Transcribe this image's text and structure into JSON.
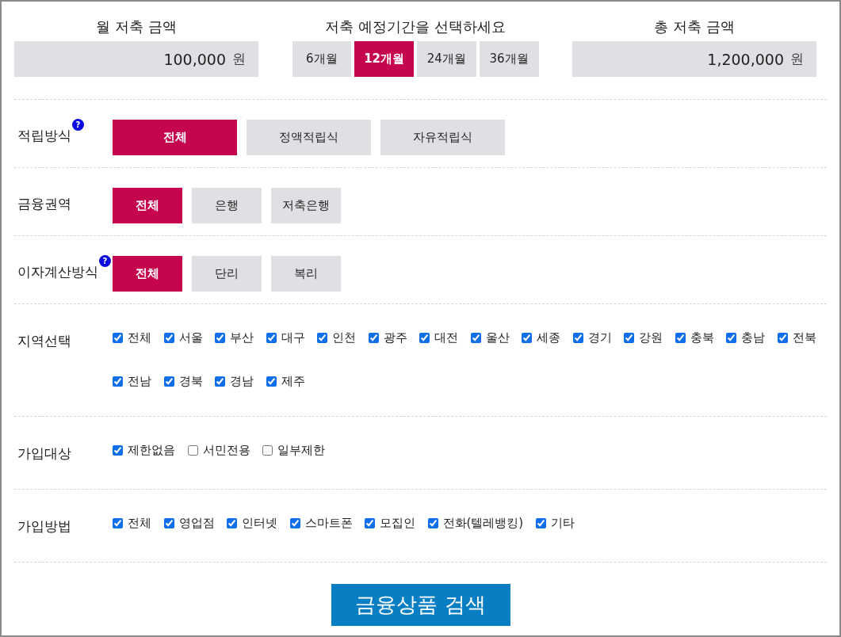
{
  "monthly_savings": {
    "label": "월 저축 금액",
    "value": "100,000",
    "unit": "원"
  },
  "period": {
    "label": "저축 예정기간을 선택하세요",
    "options": [
      {
        "label": "6개월",
        "selected": false
      },
      {
        "label": "12개월",
        "selected": true
      },
      {
        "label": "24개월",
        "selected": false
      },
      {
        "label": "36개월",
        "selected": false
      }
    ]
  },
  "total_savings": {
    "label": "총 저축 금액",
    "value": "1,200,000",
    "unit": "원"
  },
  "filters": [
    {
      "kind": "wide",
      "label": "적립방식",
      "help": "?",
      "options": [
        {
          "label": "전체",
          "selected": true
        },
        {
          "label": "정액적립식",
          "selected": false
        },
        {
          "label": "자유적립식",
          "selected": false
        }
      ]
    },
    {
      "kind": "buttons",
      "label": "금융권역",
      "options": [
        {
          "label": "전체",
          "selected": true
        },
        {
          "label": "은행",
          "selected": false
        },
        {
          "label": "저축은행",
          "selected": false
        }
      ]
    },
    {
      "kind": "buttons",
      "label": "이자계산방식",
      "help": "?",
      "options": [
        {
          "label": "전체",
          "selected": true
        },
        {
          "label": "단리",
          "selected": false
        },
        {
          "label": "복리",
          "selected": false
        }
      ]
    },
    {
      "kind": "checkboxes",
      "label": "지역선택",
      "options": [
        {
          "label": "전체",
          "checked": true
        },
        {
          "label": "서울",
          "checked": true
        },
        {
          "label": "부산",
          "checked": true
        },
        {
          "label": "대구",
          "checked": true
        },
        {
          "label": "인천",
          "checked": true
        },
        {
          "label": "광주",
          "checked": true
        },
        {
          "label": "대전",
          "checked": true
        },
        {
          "label": "울산",
          "checked": true
        },
        {
          "label": "세종",
          "checked": true
        },
        {
          "label": "경기",
          "checked": true
        },
        {
          "label": "강원",
          "checked": true
        },
        {
          "label": "충북",
          "checked": true
        },
        {
          "label": "충남",
          "checked": true
        },
        {
          "label": "전북",
          "checked": true
        },
        {
          "label": "전남",
          "checked": true
        },
        {
          "label": "경북",
          "checked": true
        },
        {
          "label": "경남",
          "checked": true
        },
        {
          "label": "제주",
          "checked": true
        }
      ]
    },
    {
      "kind": "checkboxes",
      "label": "가입대상",
      "options": [
        {
          "label": "제한없음",
          "checked": true
        },
        {
          "label": "서민전용",
          "checked": false
        },
        {
          "label": "일부제한",
          "checked": false
        }
      ]
    },
    {
      "kind": "checkboxes",
      "label": "가입방법",
      "options": [
        {
          "label": "전체",
          "checked": true
        },
        {
          "label": "영업점",
          "checked": true
        },
        {
          "label": "인터넷",
          "checked": true
        },
        {
          "label": "스마트폰",
          "checked": true
        },
        {
          "label": "모집인",
          "checked": true
        },
        {
          "label": "전화(텔레뱅킹)",
          "checked": true
        },
        {
          "label": "기타",
          "checked": true
        }
      ]
    }
  ],
  "search_button": "금융상품 검색"
}
